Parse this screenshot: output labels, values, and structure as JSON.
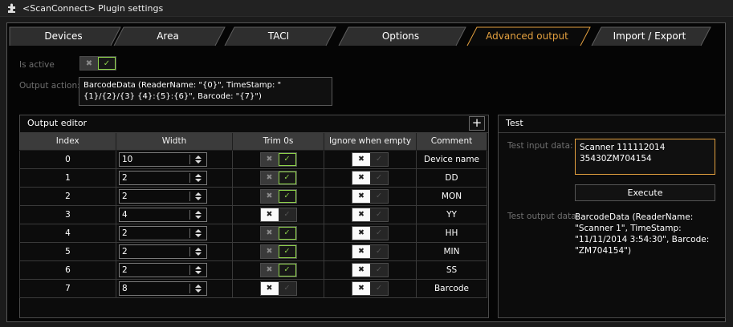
{
  "window": {
    "title": "<ScanConnect> Plugin settings",
    "icon": "puzzle-piece-icon"
  },
  "tabs": [
    {
      "label": "Devices",
      "active": false
    },
    {
      "label": "Area",
      "active": false
    },
    {
      "label": "TACI",
      "active": false
    },
    {
      "label": "Options",
      "active": false
    },
    {
      "label": "Advanced output",
      "active": true
    },
    {
      "label": "Import / Export",
      "active": false
    }
  ],
  "general": {
    "is_active_label": "Is active",
    "is_active": true,
    "output_action_label": "Output action:",
    "output_action": "BarcodeData (ReaderName: \"{0}\", TimeStamp: \"{1}/{2}/{3} {4}:{5}:{6}\", Barcode: \"{7}\")"
  },
  "output_editor": {
    "title": "Output editor",
    "add_icon": "plus-icon",
    "columns": [
      "Index",
      "Width",
      "Trim 0s",
      "Ignore when empty",
      "Comment"
    ],
    "rows": [
      {
        "index": "0",
        "width": "10",
        "trim": true,
        "ignore": false,
        "comment": "Device name"
      },
      {
        "index": "1",
        "width": "2",
        "trim": true,
        "ignore": false,
        "comment": "DD"
      },
      {
        "index": "2",
        "width": "2",
        "trim": true,
        "ignore": false,
        "comment": "MON"
      },
      {
        "index": "3",
        "width": "4",
        "trim": false,
        "ignore": false,
        "comment": "YY"
      },
      {
        "index": "4",
        "width": "2",
        "trim": true,
        "ignore": false,
        "comment": "HH"
      },
      {
        "index": "5",
        "width": "2",
        "trim": true,
        "ignore": false,
        "comment": "MIN"
      },
      {
        "index": "6",
        "width": "2",
        "trim": true,
        "ignore": false,
        "comment": "SS"
      },
      {
        "index": "7",
        "width": "8",
        "trim": false,
        "ignore": false,
        "comment": "Barcode"
      }
    ]
  },
  "test": {
    "title": "Test",
    "input_label": "Test input data:",
    "input_value": " Scanner 111112014\n35430ZM704154",
    "execute_label": "Execute",
    "output_label": "Test output data:",
    "output_value": "BarcodeData (ReaderName: \"Scanner 1\", TimeStamp: \"11/11/2014 3:54:30\", Barcode: \"ZM704154\")"
  },
  "colors": {
    "accent": "#e3a03f",
    "toggle_on": "#8ed34a",
    "background": "#050505"
  },
  "toggle_glyphs": {
    "off": "✖",
    "on": "✓"
  }
}
